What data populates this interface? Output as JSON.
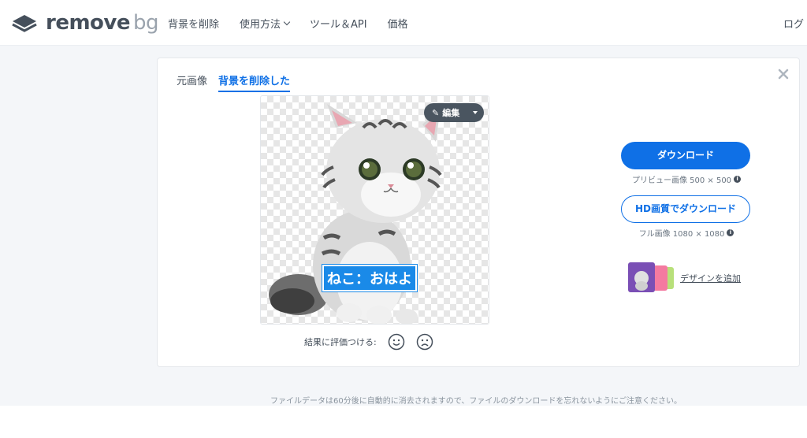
{
  "header": {
    "logo_main": "remove",
    "logo_sub": "bg",
    "nav": [
      "背景を削除",
      "使用方法",
      "ツール＆API",
      "価格"
    ],
    "login": "ログ"
  },
  "tabs": [
    "元画像",
    "背景を削除した"
  ],
  "preview": {
    "caption": "ねこ：おはよ",
    "edit_label": "編集"
  },
  "rating": {
    "label": "結果に評価つける:"
  },
  "download": {
    "button_label": "ダウンロード",
    "preview_size": "プリビュー画像 500 × 500",
    "hd_button_label": "HD画質でダウンロード",
    "full_size": "フル画像 1080 × 1080"
  },
  "design": {
    "link_label": "デザインを追加"
  },
  "footer": {
    "note": "ファイルデータは60分後に自動的に消去されますので、ファイルのダウンロードを忘れないようにご注意ください。"
  },
  "colors": {
    "accent": "#0f70e6",
    "text": "#454f5b",
    "background": "#f4f6f9"
  }
}
